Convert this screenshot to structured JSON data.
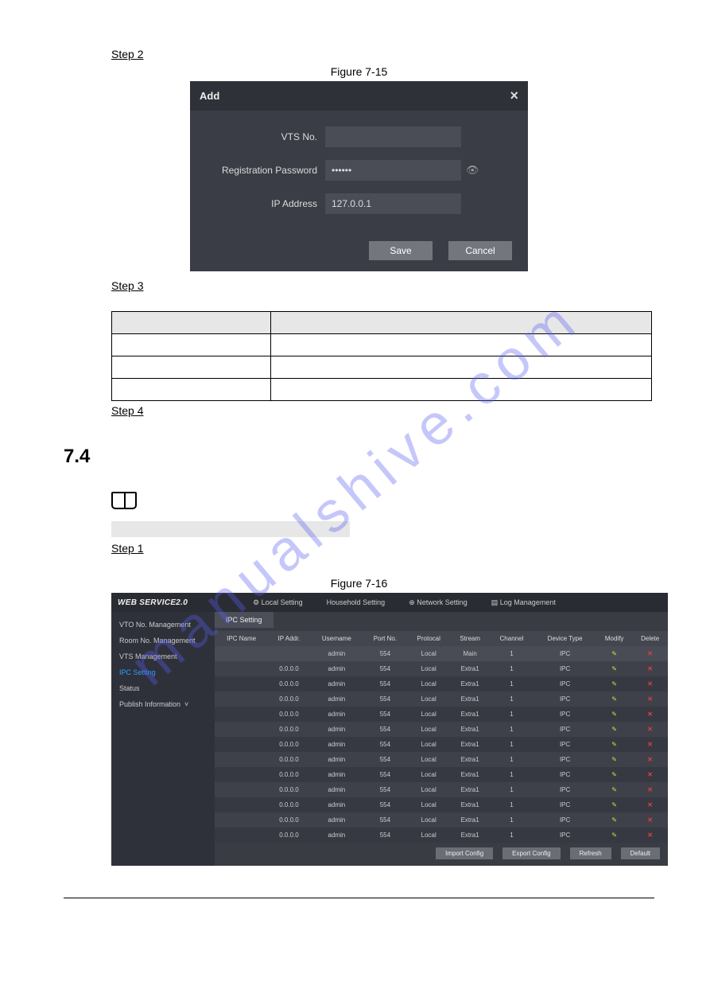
{
  "watermark": "manualshive.com",
  "step2_label": "Step 2",
  "figure715_caption": "Figure 7-15",
  "dialog": {
    "title": "Add",
    "close": "×",
    "vts_label": "VTS No.",
    "vts_value": "",
    "regpwd_label": "Registration Password",
    "regpwd_value": "••••••",
    "ip_label": "IP Address",
    "ip_value": "127.0.0.1",
    "save": "Save",
    "cancel": "Cancel"
  },
  "step3_label": "Step 3",
  "param_table": {
    "headers": [
      "",
      ""
    ],
    "rows": [
      [
        "",
        ""
      ],
      [
        "",
        ""
      ],
      [
        "",
        ""
      ]
    ]
  },
  "step4_label": "Step 4",
  "section_number": "7.4",
  "step1_label": "Step 1",
  "figure716_caption": "Figure 7-16",
  "ipc": {
    "brand": "WEB SERVICE2.0",
    "nav": {
      "local": "Local Setting",
      "household": "Household Setting",
      "network": "Network Setting",
      "log": "Log Management"
    },
    "sidebar": {
      "vto_no": "VTO No. Management",
      "room_no": "Room No. Management",
      "vts": "VTS Management",
      "ipc": "IPC Setting",
      "status": "Status",
      "publish": "Publish Information"
    },
    "tab": "IPC Setting",
    "columns": [
      "IPC Name",
      "IP Addr.",
      "Username",
      "Port No.",
      "Protocal",
      "Stream",
      "Channel",
      "Device Type",
      "Modify",
      "Delete"
    ],
    "rows": [
      {
        "name": "",
        "ip": "",
        "user": "admin",
        "port": "554",
        "proto": "Local",
        "stream": "Main",
        "ch": "1",
        "type": "IPC"
      },
      {
        "name": "",
        "ip": "0.0.0.0",
        "user": "admin",
        "port": "554",
        "proto": "Local",
        "stream": "Extra1",
        "ch": "1",
        "type": "IPC"
      },
      {
        "name": "",
        "ip": "0.0.0.0",
        "user": "admin",
        "port": "554",
        "proto": "Local",
        "stream": "Extra1",
        "ch": "1",
        "type": "IPC"
      },
      {
        "name": "",
        "ip": "0.0.0.0",
        "user": "admin",
        "port": "554",
        "proto": "Local",
        "stream": "Extra1",
        "ch": "1",
        "type": "IPC"
      },
      {
        "name": "",
        "ip": "0.0.0.0",
        "user": "admin",
        "port": "554",
        "proto": "Local",
        "stream": "Extra1",
        "ch": "1",
        "type": "IPC"
      },
      {
        "name": "",
        "ip": "0.0.0.0",
        "user": "admin",
        "port": "554",
        "proto": "Local",
        "stream": "Extra1",
        "ch": "1",
        "type": "IPC"
      },
      {
        "name": "",
        "ip": "0.0.0.0",
        "user": "admin",
        "port": "554",
        "proto": "Local",
        "stream": "Extra1",
        "ch": "1",
        "type": "IPC"
      },
      {
        "name": "",
        "ip": "0.0.0.0",
        "user": "admin",
        "port": "554",
        "proto": "Local",
        "stream": "Extra1",
        "ch": "1",
        "type": "IPC"
      },
      {
        "name": "",
        "ip": "0.0.0.0",
        "user": "admin",
        "port": "554",
        "proto": "Local",
        "stream": "Extra1",
        "ch": "1",
        "type": "IPC"
      },
      {
        "name": "",
        "ip": "0.0.0.0",
        "user": "admin",
        "port": "554",
        "proto": "Local",
        "stream": "Extra1",
        "ch": "1",
        "type": "IPC"
      },
      {
        "name": "",
        "ip": "0.0.0.0",
        "user": "admin",
        "port": "554",
        "proto": "Local",
        "stream": "Extra1",
        "ch": "1",
        "type": "IPC"
      },
      {
        "name": "",
        "ip": "0.0.0.0",
        "user": "admin",
        "port": "554",
        "proto": "Local",
        "stream": "Extra1",
        "ch": "1",
        "type": "IPC"
      },
      {
        "name": "",
        "ip": "0.0.0.0",
        "user": "admin",
        "port": "554",
        "proto": "Local",
        "stream": "Extra1",
        "ch": "1",
        "type": "IPC"
      }
    ],
    "buttons": {
      "import": "Import Config",
      "export": "Export Config",
      "refresh": "Refresh",
      "default": "Default"
    }
  }
}
